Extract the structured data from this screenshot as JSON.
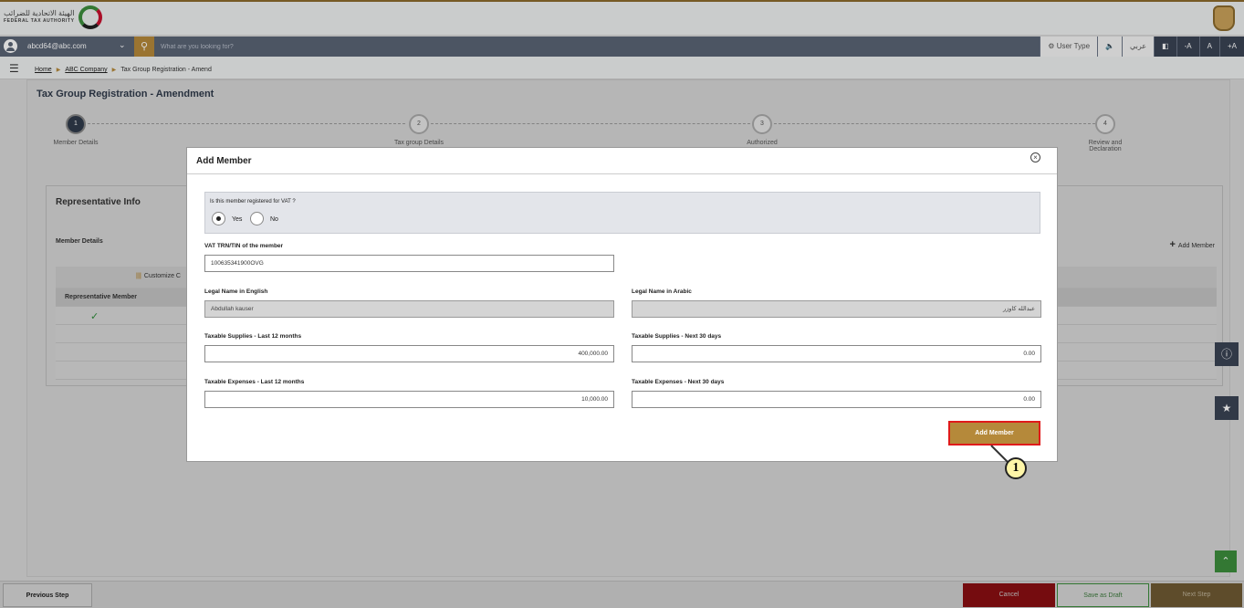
{
  "header": {
    "logo_ar": "الهيئة الاتحادية للضرائب",
    "logo_en": "FEDERAL TAX AUTHORITY"
  },
  "navbar": {
    "user_email": "abcd64@abc.com",
    "search_placeholder": "What are you looking for?",
    "user_type": "User Type",
    "arabic_label": "عربي",
    "font_small": "-A",
    "font_normal": "A",
    "font_large": "+A"
  },
  "breadcrumb": {
    "home": "Home",
    "company": "ABC Company",
    "current": "Tax Group Registration - Amend"
  },
  "page": {
    "title": "Tax Group Registration - Amendment",
    "steps": [
      {
        "num": "1",
        "label": "Member Details"
      },
      {
        "num": "2",
        "label": "Tax group Details"
      },
      {
        "num": "3",
        "label": "Authorized"
      },
      {
        "num": "4",
        "label": "Review and Declaration"
      }
    ],
    "rep_title": "Representative Info",
    "rep_sub": "Member Details",
    "rep_add": "Add Member",
    "customize": "Customize C",
    "rep_col": "Representative Member"
  },
  "modal": {
    "title": "Add Member",
    "vat_question": "Is this member registered for VAT ?",
    "yes": "Yes",
    "no": "No",
    "trn_label": "VAT TRN/TIN of the member",
    "trn_value": "100635341900OVG",
    "legal_en_label": "Legal Name in English",
    "legal_en_value": "Abdullah kauser",
    "legal_ar_label": "Legal Name in Arabic",
    "legal_ar_value": "عبدالله كاوزر",
    "supplies_12_label": "Taxable Supplies - Last 12 months",
    "supplies_12_value": "400,000.00",
    "supplies_30_label": "Taxable Supplies - Next 30 days",
    "supplies_30_value": "0.00",
    "expenses_12_label": "Taxable Expenses - Last 12 months",
    "expenses_12_value": "10,000.00",
    "expenses_30_label": "Taxable Expenses - Next 30 days",
    "expenses_30_value": "0.00",
    "add_button": "Add Member"
  },
  "callout": "1",
  "footer": {
    "previous": "Previous Step",
    "cancel": "Cancel",
    "draft": "Save as Draft",
    "next": "Next Step"
  }
}
